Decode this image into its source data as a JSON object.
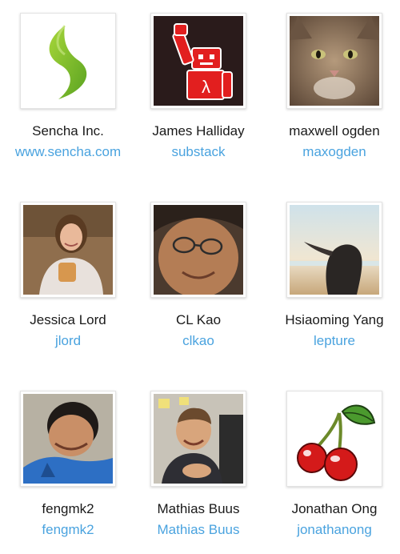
{
  "people": [
    {
      "name": "Sencha Inc.",
      "handle": "www.sencha.com",
      "avatar": "sencha-logo-icon"
    },
    {
      "name": "James Halliday",
      "handle": "substack",
      "avatar": "robot-avatar"
    },
    {
      "name": "maxwell ogden",
      "handle": "maxogden",
      "avatar": "cat-photo"
    },
    {
      "name": "Jessica Lord",
      "handle": "jlord",
      "avatar": "person-photo"
    },
    {
      "name": "CL Kao",
      "handle": "clkao",
      "avatar": "person-photo"
    },
    {
      "name": "Hsiaoming Yang",
      "handle": "lepture",
      "avatar": "beach-photo"
    },
    {
      "name": "fengmk2",
      "handle": "fengmk2",
      "avatar": "person-photo"
    },
    {
      "name": "Mathias Buus",
      "handle": "Mathias Buus",
      "avatar": "person-photo"
    },
    {
      "name": "Jonathan Ong",
      "handle": "jonathanong",
      "avatar": "cherries-icon"
    }
  ],
  "colors": {
    "link": "#4aa3df",
    "name": "#1a1a1a"
  }
}
